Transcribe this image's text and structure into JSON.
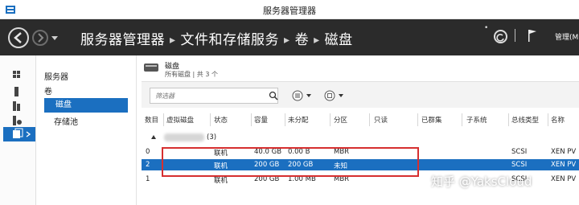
{
  "window": {
    "title": "服务器管理器"
  },
  "header": {
    "breadcrumb": [
      "服务器管理器",
      "文件和存储服务",
      "卷",
      "磁盘"
    ],
    "manage_label": "管理(M)"
  },
  "nav": {
    "items": [
      {
        "label": "服务器"
      },
      {
        "label": "卷"
      },
      {
        "label": "磁盘"
      },
      {
        "label": "存储池"
      }
    ]
  },
  "main": {
    "title": "磁盘",
    "subtitle": "所有磁盘 | 共 3 个",
    "filter_placeholder": "筛选器",
    "columns": [
      "数目",
      "虚拟磁盘",
      "状态",
      "容量",
      "未分配",
      "分区",
      "只读",
      "已群集",
      "子系统",
      "总线类型",
      "名称"
    ],
    "group_count": "(3)",
    "rows": [
      {
        "num": "0",
        "status": "联机",
        "capacity": "40.0 GB",
        "unalloc": "0.00 B",
        "partition": "MBR",
        "bus": "SCSI",
        "name": "XEN PV"
      },
      {
        "num": "2",
        "status": "联机",
        "capacity": "200 GB",
        "unalloc": "200 GB",
        "partition": "未知",
        "bus": "SCSI",
        "name": "XEN PV"
      },
      {
        "num": "1",
        "status": "联机",
        "capacity": "200 GB",
        "unalloc": "1.00 MB",
        "partition": "MBR",
        "bus": "SCSI",
        "name": "XEN PV"
      }
    ]
  },
  "watermark": "知乎 @YaksCloud",
  "colors": {
    "header_bg": "#2b2b2b",
    "selection": "#1b6fc0",
    "highlight_box": "#d62f2f"
  }
}
